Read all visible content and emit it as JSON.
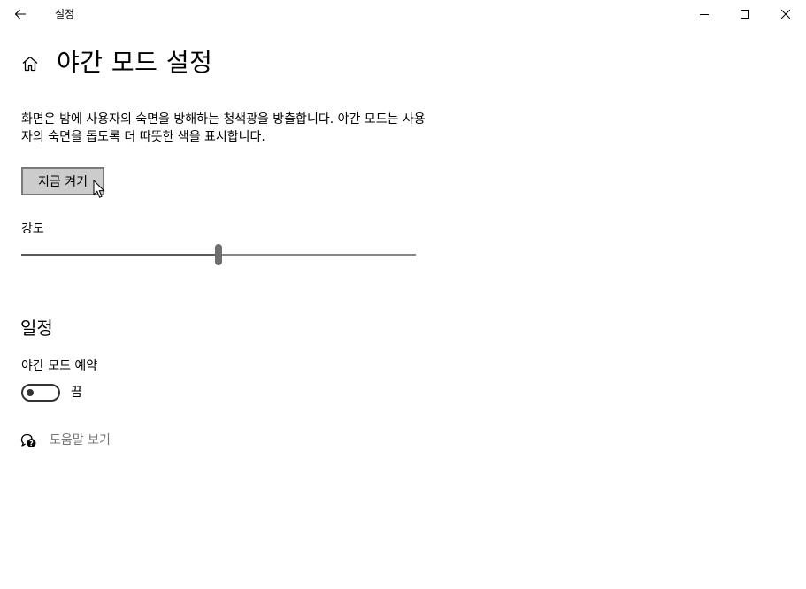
{
  "window": {
    "title": "설정",
    "back_icon": "back-arrow-icon",
    "controls": [
      "minimize-icon",
      "maximize-icon",
      "close-icon"
    ]
  },
  "header": {
    "home_icon": "home-icon",
    "title": "야간 모드 설정"
  },
  "main": {
    "description": "화면은 밤에 사용자의 숙면을 방해하는 청색광을 방출합니다. 야간 모드는 사용자의 숙면을 돕도록 더 따뜻한 색을 표시합니다.",
    "turn_on_button": "지금 켜기",
    "strength": {
      "label": "강도",
      "value_fraction": 0.5
    },
    "schedule": {
      "heading": "일정",
      "toggle_label": "야간 모드 예약",
      "toggle_state": "끔",
      "toggle_on": false
    },
    "help": {
      "icon": "help-chat-icon",
      "link": "도움말 보기"
    }
  },
  "colors": {
    "background": "#ffffff",
    "button_bg": "#cccccc",
    "link_gray": "#767676"
  }
}
